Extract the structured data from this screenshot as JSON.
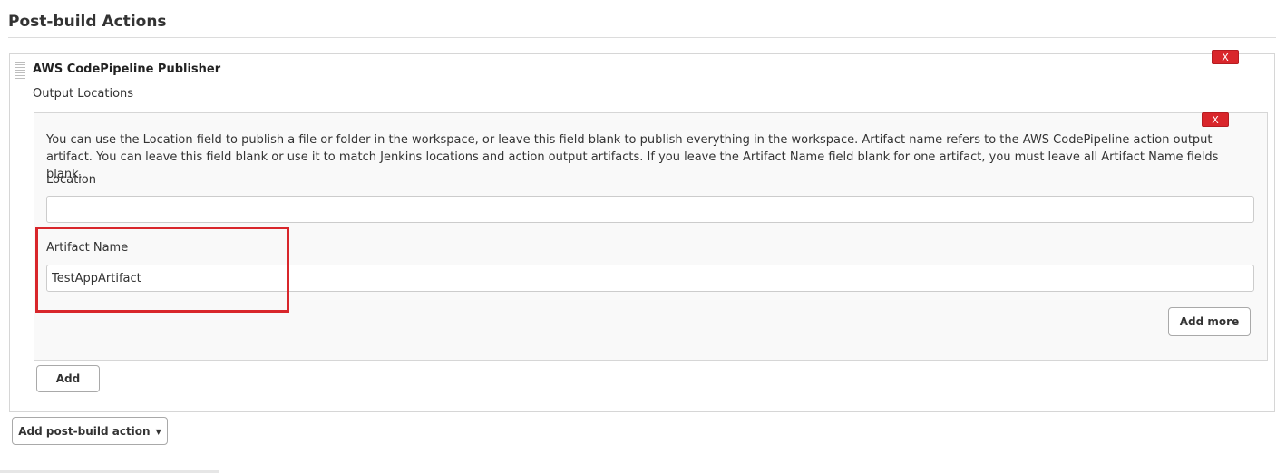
{
  "section": {
    "title": "Post-build Actions"
  },
  "publisher": {
    "title": "AWS CodePipeline Publisher",
    "output_locations_label": "Output Locations",
    "delete_label": "X"
  },
  "location_entry": {
    "delete_label": "X",
    "description": "You can use the Location field to publish a file or folder in the workspace, or leave this field blank to publish everything in the workspace. Artifact name refers to the AWS CodePipeline action output artifact. You can leave this field blank or use it to match Jenkins locations and action output artifacts. If you leave the Artifact Name field blank for one artifact, you must leave all Artifact Name fields blank.",
    "location_label": "Location",
    "location_value": "",
    "artifact_label": "Artifact Name",
    "artifact_value": "TestAppArtifact",
    "add_more_label": "Add more"
  },
  "actions": {
    "add_label": "Add",
    "add_post_build_label": "Add post-build action",
    "caret_icon": "caret-down-icon"
  },
  "colors": {
    "highlight": "#d8262b",
    "delete_button": "#d9262b"
  }
}
